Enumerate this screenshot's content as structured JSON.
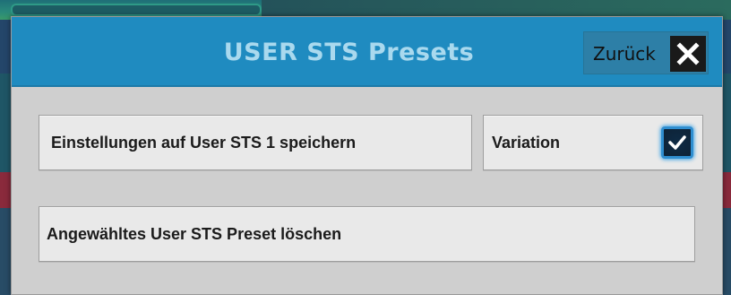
{
  "dialog": {
    "title": "USER STS Presets",
    "back_label": "Zurück",
    "close_icon": "close-icon"
  },
  "actions": {
    "save_label": "Einstellungen auf User STS 1 speichern",
    "variation_label": "Variation",
    "variation_checked": true,
    "delete_label": "Angewähltes User STS Preset löschen"
  },
  "colors": {
    "header_bg": "#1f8bc0",
    "title_text": "#a9d9ee",
    "dialog_bg": "#cfcfcf",
    "button_bg": "#e9e9e9",
    "checkbox_accent": "#2f8ed0"
  }
}
